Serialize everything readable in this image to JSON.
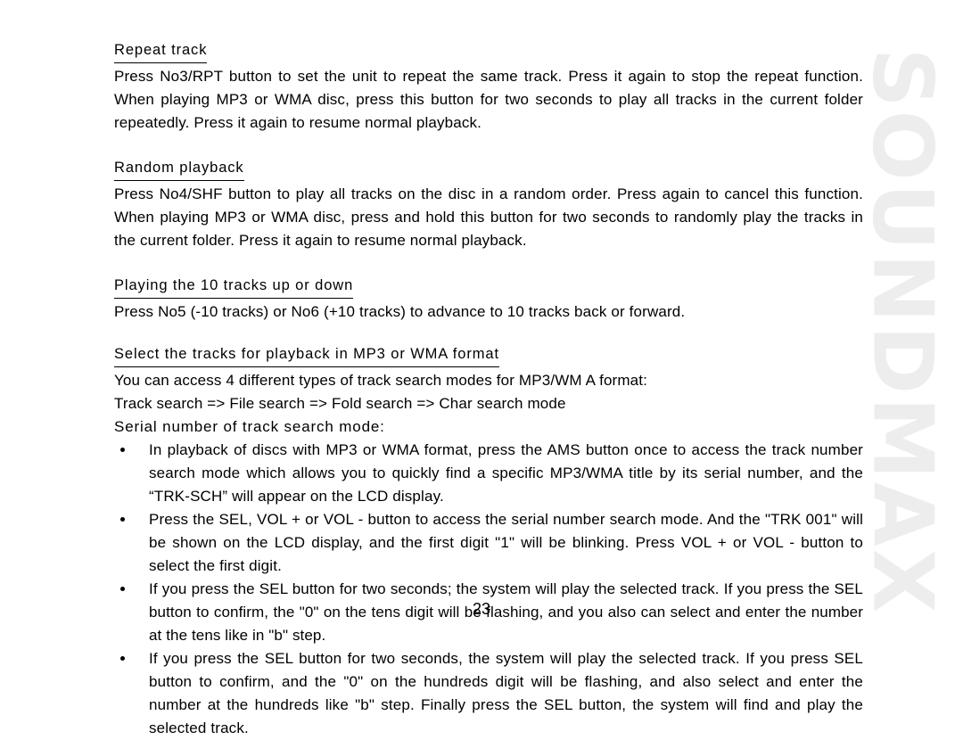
{
  "document": {
    "brand_watermark": "SOUNDMAX",
    "watermark_color": "#ededed",
    "page_number": "23",
    "text_color": "#000000",
    "background_color": "#ffffff"
  },
  "sections": [
    {
      "heading": "Repeat track",
      "paragraph": "Press No3/RPT button to set the unit to repeat the same track. Press it again to stop the repeat function. When playing MP3 or WMA disc, press this button for two seconds to play all tracks in the current folder repeatedly. Press it again to resume normal playback."
    },
    {
      "heading": "Random playback",
      "paragraph": "Press No4/SHF button to play all tracks on the disc in a random order. Press again to cancel this function. When playing MP3 or WMA disc, press and hold this button for two seconds to randomly play the tracks in the current folder. Press it again to resume normal playback."
    },
    {
      "heading": "Playing the 10 tracks up or down",
      "paragraph": "Press No5 (-10 tracks) or No6 (+10 tracks) to advance to 10 tracks back or forward."
    },
    {
      "heading": "Select the tracks for playback in MP3 or WMA format",
      "line1": "You can access 4 different types of track search modes for MP3/WM A format:",
      "line2": "Track search => File search => Fold search => Char search mode",
      "line3": "Serial number of track search mode:"
    }
  ],
  "bullets": [
    "In playback of discs with MP3 or WMA format, press the AMS button once to access the track number search mode which allows you to quickly find a specific MP3/WMA title by its serial number, and the “TRK-SCH” will appear on the LCD display.",
    "Press the SEL, VOL + or VOL - button to access the serial number search mode. And the \"TRK 001\" will be shown on the LCD display, and the first digit \"1\" will be blinking. Press VOL + or VOL - button to select the first digit.",
    "If you press the SEL button for two seconds; the system will play the selected track. If you press the SEL button to confirm, the \"0\" on the tens digit will be flashing, and you also can select and enter the number at the tens like in \"b\" step.",
    "If you press the SEL button for two seconds, the system will play the selected track. If you press SEL button to confirm, and the \"0\" on the hundreds digit will be flashing, and also select and enter the number at the hundreds like \"b\" step. Finally press the SEL button, the system will find and play the selected track."
  ]
}
